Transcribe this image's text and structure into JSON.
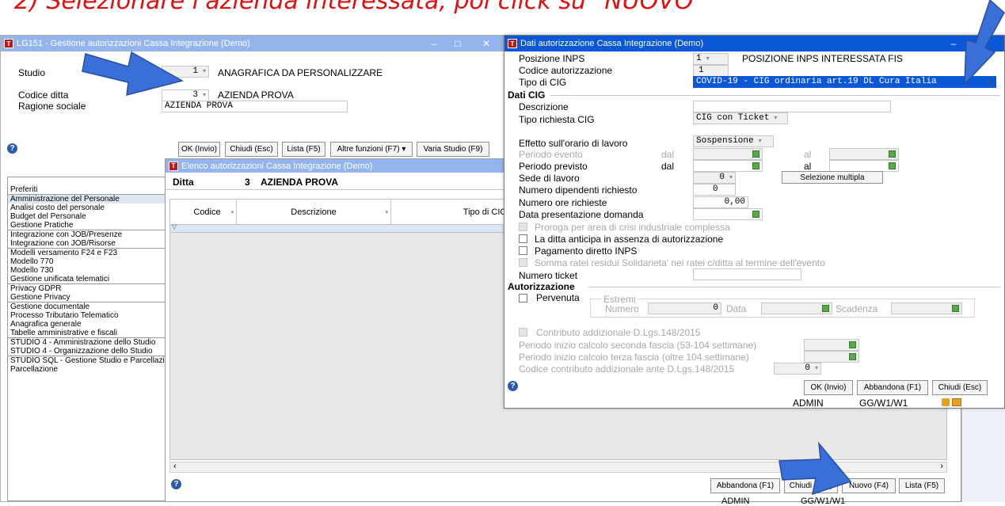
{
  "caption": "2) Selezionare l'azienda interessata, poi click su \"NUOVO\"",
  "colors": {
    "caption": "#e01010",
    "arrow": "#3b6fd8",
    "title_active": "#0a58d8",
    "title_inactive": "#93b4ec",
    "selection": "#0a58d8"
  },
  "main_window": {
    "title": "LG151 - Gestione autorizzazioni Cassa Integrazione (Demo)",
    "studio_label": "Studio",
    "studio_value": "1",
    "studio_desc": "ANAGRAFICA DA PERSONALIZZARE",
    "codice_ditta_label": "Codice ditta",
    "codice_ditta_value": "3",
    "codice_ditta_desc": "AZIENDA PROVA",
    "ragione_sociale_label": "Ragione sociale",
    "ragione_sociale_value": "AZIENDA PROVA",
    "help_icon": "question-circle-icon",
    "buttons": {
      "ok": "OK (Invio)",
      "chiudi": "Chiudi (Esc)",
      "lista": "Lista (F5)",
      "altre": "Altre funzioni (F7) ▾",
      "varia": "Varia Studio (F9)"
    }
  },
  "sidebar": {
    "groups": [
      [
        "Preferiti"
      ],
      [
        "Amministrazione del Personale",
        "Analisi costo del personale",
        "Budget del Personale",
        "Gestione Pratiche"
      ],
      [
        "Integrazione con JOB/Presenze",
        "Integrazione con JOB/Risorse"
      ],
      [
        "Modelli versamento F24 e F23",
        "Modello 770",
        "Modello 730",
        "Gestione unificata telematici"
      ],
      [
        "Privacy GDPR",
        "Gestione Privacy"
      ],
      [
        "Gestione documentale",
        "Processo Tributario Telematico",
        "Anagrafica generale",
        "Tabelle amministrative e fiscali"
      ],
      [
        "STUDIO 4 - Amministrazione dello Studio",
        "STUDIO 4 - Organizzazione dello Studio"
      ],
      [
        "STUDIO SQL - Gestione Studio e Parcellazione",
        "Parcellazione"
      ]
    ]
  },
  "list_window": {
    "title": "Elenco autorizzazioni Cassa Integrazione (Demo)",
    "ditta_label": "Ditta",
    "ditta_value": "3",
    "ditta_name": "AZIENDA PROVA",
    "columns": [
      "Codice",
      "Descrizione",
      "Tipo di CIG"
    ],
    "buttons": {
      "abbandona": "Abbandona (F1)",
      "chiudi": "Chiudi (Esc)",
      "nuovo": "Nuovo (F4)",
      "lista": "Lista (F5)"
    },
    "status_user": "ADMIN",
    "status_code": "GG/W1/W1"
  },
  "detail_window": {
    "title": "Dati autorizzazione Cassa Integrazione (Demo)",
    "posizione_inps_label": "Posizione INPS",
    "posizione_inps_value": "1",
    "posizione_inps_desc": "POSIZIONE INPS INTERESSATA FIS",
    "codice_autorizzazione_label": "Codice autorizzazione",
    "codice_autorizzazione_value": "1",
    "tipo_cig_label": "Tipo di CIG",
    "tipo_cig_value": "COVID-19 - CIG ordinaria art.19 DL Cura Italia",
    "dati_cig_title": "Dati CIG",
    "descrizione_label": "Descrizione",
    "tipo_richiesta_label": "Tipo richiesta CIG",
    "tipo_richiesta_value": "CIG con Ticket",
    "effetto_label": "Effetto sull'orario di lavoro",
    "effetto_value": "Sospensione",
    "periodo_evento_label": "Periodo evento",
    "periodo_previsto_label": "Periodo previsto",
    "dal_label": "dal",
    "al_label": "al",
    "sede_label": "Sede di lavoro",
    "sede_value": "0",
    "selezione_multipla": "Selezione multipla",
    "num_dipendenti_label": "Numero dipendenti richiesto",
    "num_dipendenti_value": "0",
    "num_ore_label": "Numero ore richieste",
    "num_ore_value": "0,00",
    "data_presentazione_label": "Data presentazione domanda",
    "proroga_label": "Proroga per area di crisi industriale complessa",
    "anticipa_label": "La ditta anticipa in assenza di autorizzazione",
    "pagamento_label": "Pagamento diretto INPS",
    "somma_label": "Somma ratei residui Solidarieta' nei ratei c/ditta al termine dell'evento",
    "ticket_label": "Numero ticket",
    "autorizzazione_title": "Autorizzazione",
    "pervenuta_label": "Pervenuta",
    "estremi_label": "Estremi",
    "numero_label": "Numero",
    "numero_value": "0",
    "data_label": "Data",
    "scadenza_label": "Scadenza",
    "contributo_label": "Contributo addizionale D.Lgs.148/2015",
    "seconda_fascia_label": "Periodo inizio calcolo seconda fascia (53-104 settimane)",
    "terza_fascia_label": "Periodo inizio calcolo terza fascia (oltre 104 settimane)",
    "codice_contributo_label": "Codice contributo addizionale ante D.Lgs.148/2015",
    "codice_contributo_value": "0",
    "buttons": {
      "ok": "OK (Invio)",
      "abbandona": "Abbandona (F1)",
      "chiudi": "Chiudi (Esc)"
    },
    "status_user": "ADMIN",
    "status_code": "GG/W1/W1"
  }
}
